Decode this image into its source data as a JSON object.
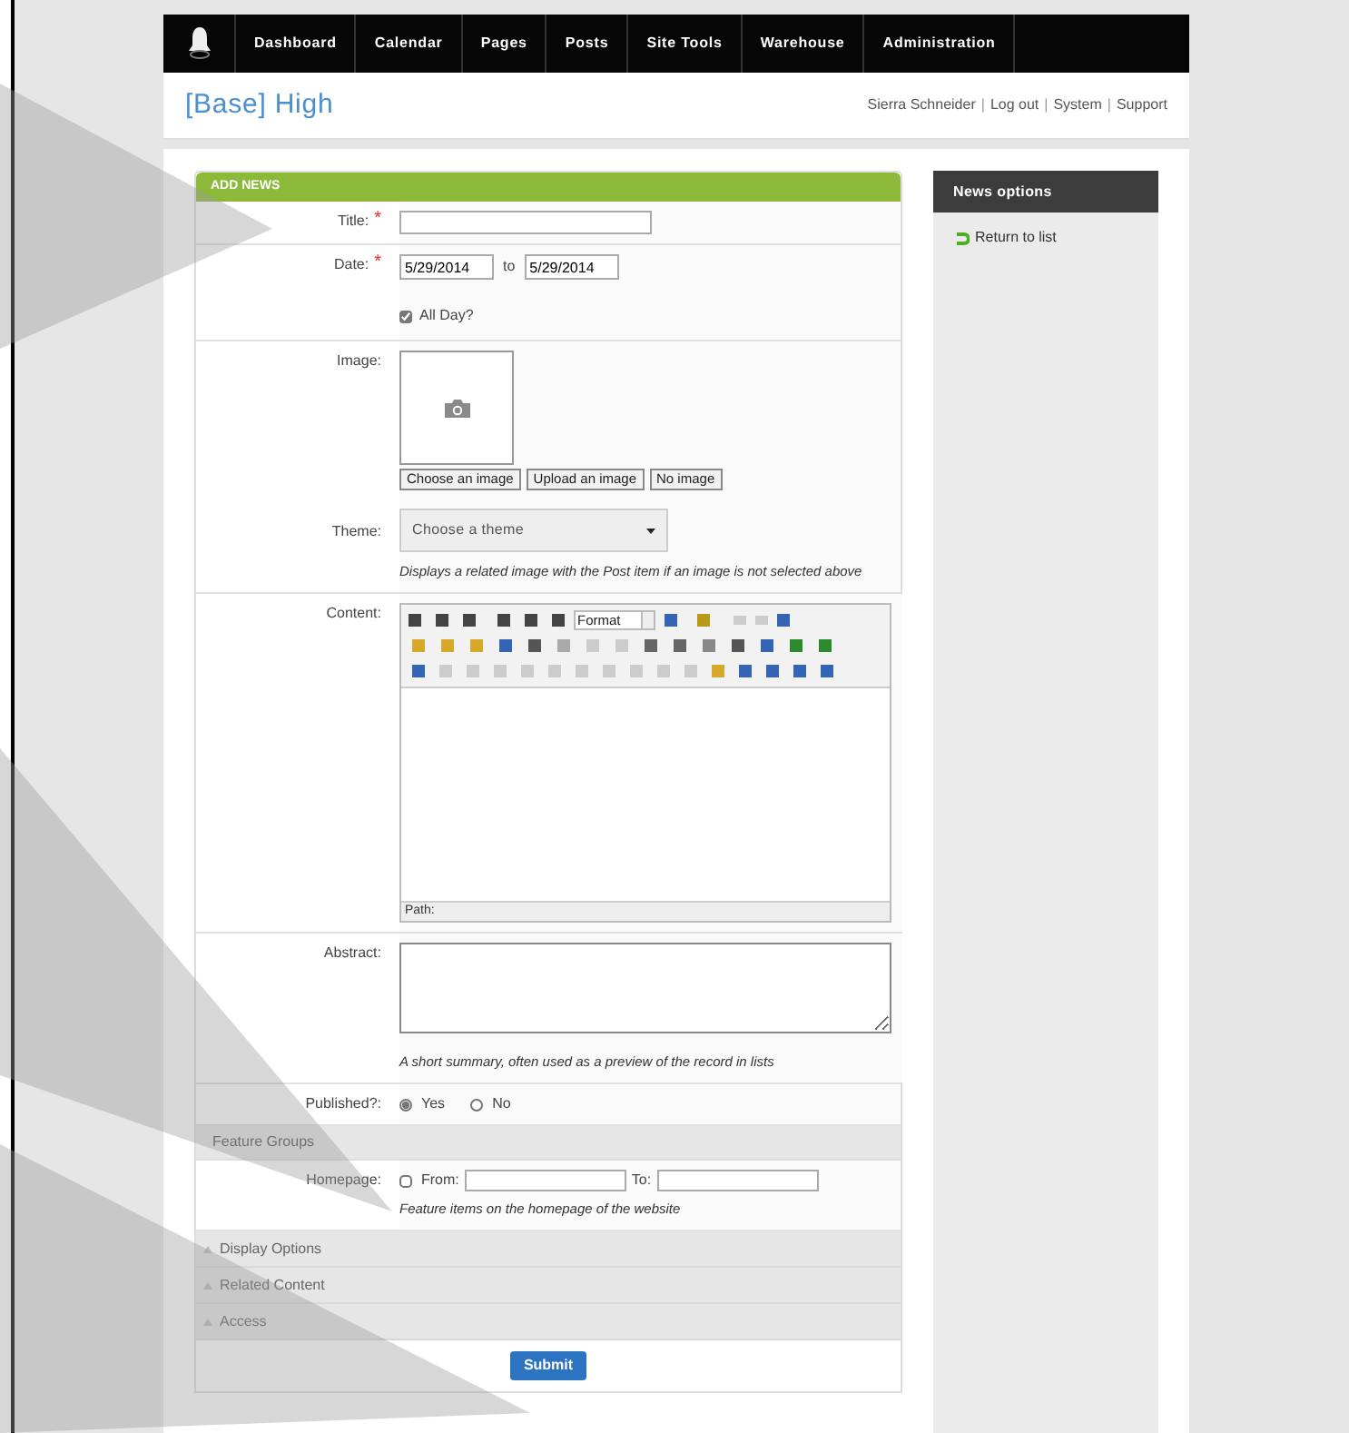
{
  "nav": {
    "items": [
      {
        "label": "Dashboard"
      },
      {
        "label": "Calendar"
      },
      {
        "label": "Pages"
      },
      {
        "label": "Posts"
      },
      {
        "label": "Site Tools"
      },
      {
        "label": "Warehouse"
      },
      {
        "label": "Administration"
      }
    ]
  },
  "header": {
    "site_title": "[Base] High",
    "user_links": [
      "Sierra Schneider",
      "Log out",
      "System",
      "Support"
    ],
    "separators": [
      "|",
      "|",
      "|"
    ]
  },
  "form": {
    "title": "ADD NEWS",
    "required_marks": [
      "*",
      "*"
    ],
    "title_label": "Title:",
    "date_label": "Date:",
    "date_from": "5/29/2014",
    "date_to_label": "to",
    "date_to": "5/29/2014",
    "all_day": {
      "label": "All Day?",
      "checked": true
    },
    "image_label": "Image:",
    "image_buttons": [
      "Choose an image",
      "Upload an image",
      "No image"
    ],
    "theme_label": "Theme:",
    "theme_placeholder": "Choose a theme",
    "theme_help": "Displays a related image with the Post item if an image is not selected above",
    "content_label": "Content:",
    "editor_format": "Format",
    "editor_path": "Path:",
    "abstract_label": "Abstract:",
    "abstract_help": "A short summary, often used as a preview of the record in lists",
    "published_label": "Published?:",
    "published_options": [
      {
        "label": "Yes",
        "selected": true
      },
      {
        "label": "No",
        "selected": false
      }
    ],
    "feature_groups": "Feature Groups",
    "homepage_label": "Homepage:",
    "homepage": {
      "checked": false,
      "from_label": "From:",
      "to_label": "To:",
      "help": "Feature items on the homepage of the website"
    },
    "sections": [
      {
        "label": "Display Options",
        "expanded": false
      },
      {
        "label": "Related Content",
        "expanded": false
      },
      {
        "label": "Access",
        "expanded": false
      }
    ],
    "submit": "Submit"
  },
  "sidebar": {
    "title": "News options",
    "links": [
      "Return to list"
    ]
  }
}
